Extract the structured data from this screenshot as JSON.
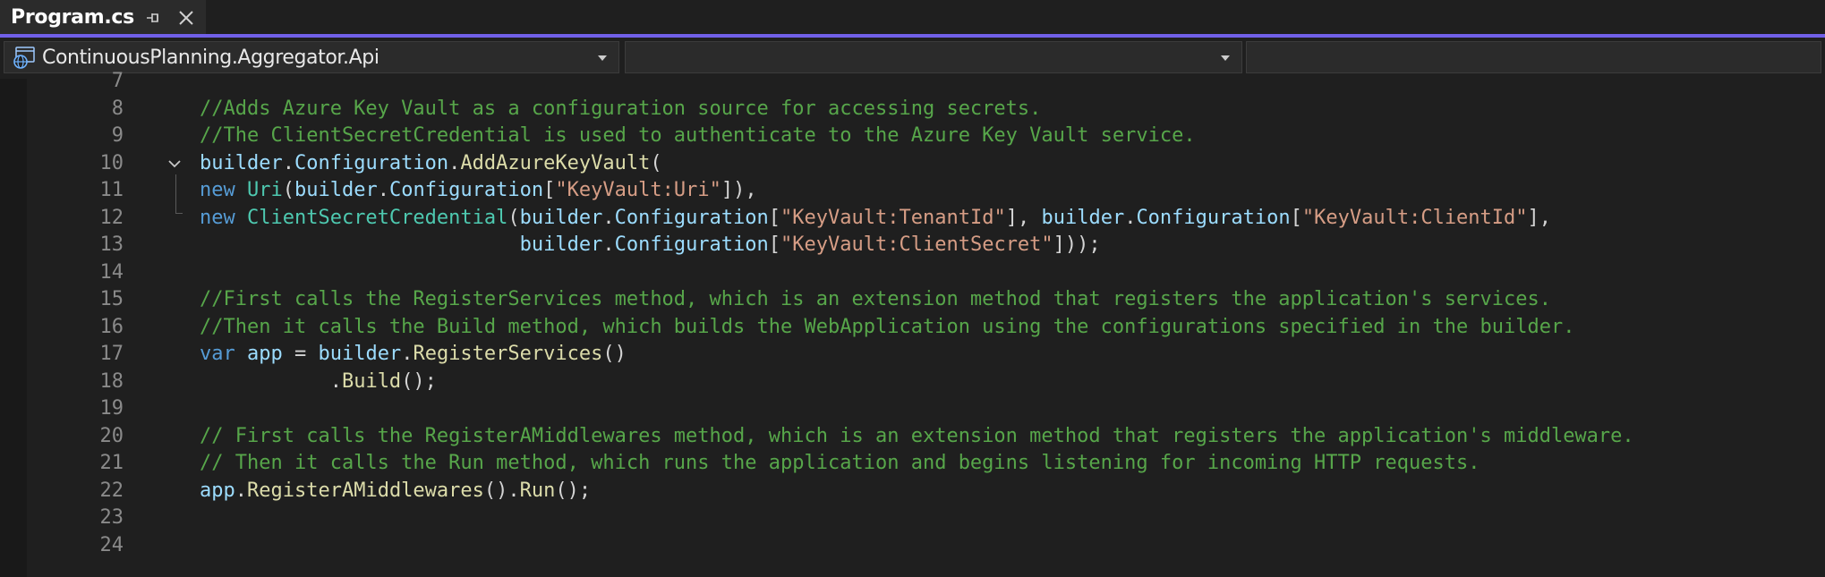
{
  "tab": {
    "title": "Program.cs",
    "pin_icon": "pin-icon",
    "close_icon": "close-icon",
    "accent_color": "#7160e8"
  },
  "navbar": {
    "project_icon": "globe-project-icon",
    "project_label": "ContinuousPlanning.Aggregator.Api",
    "type_label": "",
    "member_label": ""
  },
  "editor": {
    "lines": [
      {
        "num": "7",
        "tokens": []
      },
      {
        "num": "8",
        "tokens": [
          {
            "t": "//Adds Azure Key Vault as a configuration source for accessing secrets.",
            "c": "com"
          }
        ]
      },
      {
        "num": "9",
        "tokens": [
          {
            "t": "//The ClientSecretCredential is used to authenticate to the Azure Key Vault service.",
            "c": "com"
          }
        ]
      },
      {
        "num": "10",
        "fold": true,
        "tokens": [
          {
            "t": "builder",
            "c": "var"
          },
          {
            "t": ".",
            "c": "plain"
          },
          {
            "t": "Configuration",
            "c": "var"
          },
          {
            "t": ".",
            "c": "plain"
          },
          {
            "t": "AddAzureKeyVault",
            "c": "meth"
          },
          {
            "t": "(",
            "c": "plain"
          }
        ]
      },
      {
        "num": "11",
        "tokens": [
          {
            "t": "new ",
            "c": "kw"
          },
          {
            "t": "Uri",
            "c": "type"
          },
          {
            "t": "(",
            "c": "plain"
          },
          {
            "t": "builder",
            "c": "var"
          },
          {
            "t": ".",
            "c": "plain"
          },
          {
            "t": "Configuration",
            "c": "var"
          },
          {
            "t": "[",
            "c": "plain"
          },
          {
            "t": "\"KeyVault:Uri\"",
            "c": "str"
          },
          {
            "t": "]),",
            "c": "plain"
          }
        ]
      },
      {
        "num": "12",
        "tokens": [
          {
            "t": "new ",
            "c": "kw"
          },
          {
            "t": "ClientSecretCredential",
            "c": "type"
          },
          {
            "t": "(",
            "c": "plain"
          },
          {
            "t": "builder",
            "c": "var"
          },
          {
            "t": ".",
            "c": "plain"
          },
          {
            "t": "Configuration",
            "c": "var"
          },
          {
            "t": "[",
            "c": "plain"
          },
          {
            "t": "\"KeyVault:TenantId\"",
            "c": "str"
          },
          {
            "t": "], ",
            "c": "plain"
          },
          {
            "t": "builder",
            "c": "var"
          },
          {
            "t": ".",
            "c": "plain"
          },
          {
            "t": "Configuration",
            "c": "var"
          },
          {
            "t": "[",
            "c": "plain"
          },
          {
            "t": "\"KeyVault:ClientId\"",
            "c": "str"
          },
          {
            "t": "],",
            "c": "plain"
          }
        ]
      },
      {
        "num": "13",
        "tokens": [
          {
            "t": "                           ",
            "c": "plain"
          },
          {
            "t": "builder",
            "c": "var"
          },
          {
            "t": ".",
            "c": "plain"
          },
          {
            "t": "Configuration",
            "c": "var"
          },
          {
            "t": "[",
            "c": "plain"
          },
          {
            "t": "\"KeyVault:ClientSecret\"",
            "c": "str"
          },
          {
            "t": "]));",
            "c": "plain"
          }
        ]
      },
      {
        "num": "14",
        "tokens": []
      },
      {
        "num": "15",
        "tokens": [
          {
            "t": "//First calls the RegisterServices method, which is an extension method that registers the application's services.",
            "c": "com"
          }
        ]
      },
      {
        "num": "16",
        "tokens": [
          {
            "t": "//Then it calls the Build method, which builds the WebApplication using the configurations specified in the builder.",
            "c": "com"
          }
        ]
      },
      {
        "num": "17",
        "tokens": [
          {
            "t": "var ",
            "c": "kw"
          },
          {
            "t": "app",
            "c": "var"
          },
          {
            "t": " = ",
            "c": "plain"
          },
          {
            "t": "builder",
            "c": "var"
          },
          {
            "t": ".",
            "c": "plain"
          },
          {
            "t": "RegisterServices",
            "c": "meth"
          },
          {
            "t": "()",
            "c": "plain"
          }
        ]
      },
      {
        "num": "18",
        "tokens": [
          {
            "t": "           .",
            "c": "plain"
          },
          {
            "t": "Build",
            "c": "meth"
          },
          {
            "t": "();",
            "c": "plain"
          }
        ]
      },
      {
        "num": "19",
        "tokens": []
      },
      {
        "num": "20",
        "tokens": [
          {
            "t": "// First calls the RegisterAMiddlewares method, which is an extension method that registers the application's middleware.",
            "c": "com"
          }
        ]
      },
      {
        "num": "21",
        "tokens": [
          {
            "t": "// Then it calls the Run method, which runs the application and begins listening for incoming HTTP requests.",
            "c": "com"
          }
        ]
      },
      {
        "num": "22",
        "tokens": [
          {
            "t": "app",
            "c": "var"
          },
          {
            "t": ".",
            "c": "plain"
          },
          {
            "t": "RegisterAMiddlewares",
            "c": "meth"
          },
          {
            "t": "().",
            "c": "plain"
          },
          {
            "t": "Run",
            "c": "meth"
          },
          {
            "t": "();",
            "c": "plain"
          }
        ]
      },
      {
        "num": "23",
        "tokens": []
      },
      {
        "num": "24",
        "tokens": []
      }
    ]
  }
}
